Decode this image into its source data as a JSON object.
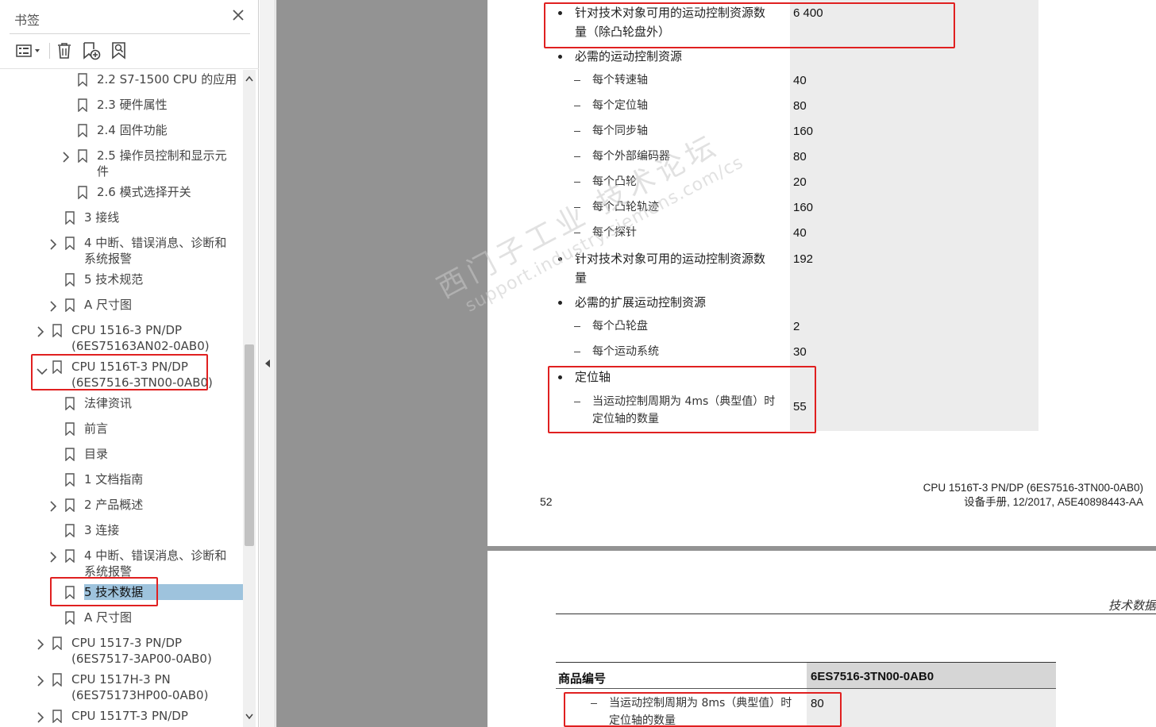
{
  "sidebar": {
    "title": "书签",
    "close_icon": "close-icon",
    "toolbar": [
      "options-menu-icon",
      "delete-bookmark-icon",
      "new-bookmark-icon",
      "find-bookmark-icon"
    ],
    "items": [
      {
        "label": "2.2 S7-1500 CPU 的应用",
        "expandable": false
      },
      {
        "label": "2.3 硬件属性",
        "expandable": false
      },
      {
        "label": "2.4 固件功能",
        "expandable": false
      },
      {
        "label": "2.5 操作员控制和显示元",
        "label2": "件",
        "expandable": true
      },
      {
        "label": "2.6 模式选择开关",
        "expandable": false
      },
      {
        "label": "3 接线",
        "expandable": false
      },
      {
        "label": "4 中断、错误消息、诊断和",
        "label2": "系统报警",
        "expandable": true
      },
      {
        "label": "5 技术规范",
        "expandable": false
      },
      {
        "label": "A 尺寸图",
        "expandable": true
      },
      {
        "label": "CPU 1516-3 PN/DP",
        "label2": "(6ES75163AN02-0AB0)",
        "expandable": true
      },
      {
        "label": "CPU 1516T-3 PN/DP",
        "label2": "(6ES7516-3TN00-0AB0)",
        "expandable": true,
        "expanded": true
      },
      {
        "label": "法律资讯",
        "expandable": false
      },
      {
        "label": "前言",
        "expandable": false
      },
      {
        "label": "目录",
        "expandable": false
      },
      {
        "label": "1 文档指南",
        "expandable": false
      },
      {
        "label": "2 产品概述",
        "expandable": true
      },
      {
        "label": "3 连接",
        "expandable": false
      },
      {
        "label": "4 中断、错误消息、诊断和",
        "label2": "系统报警",
        "expandable": true
      },
      {
        "label": "5 技术数据",
        "expandable": false,
        "selected": true
      },
      {
        "label": "A 尺寸图",
        "expandable": false
      },
      {
        "label": "CPU 1517-3 PN/DP",
        "label2": "(6ES7517-3AP00-0AB0)",
        "expandable": true
      },
      {
        "label": "CPU 1517H-3 PN",
        "label2": "(6ES75173HP00-0AB0)",
        "expandable": true
      },
      {
        "label": "CPU 1517T-3 PN/DP",
        "expandable": true
      }
    ]
  },
  "doc": {
    "rows": [
      {
        "kind": "bullet",
        "text": "针对技术对象可用的运动控制资源数",
        "text2": "量（除凸轮盘外）",
        "value": "6 400"
      },
      {
        "kind": "bullet",
        "text": "必需的运动控制资源",
        "value": ""
      },
      {
        "kind": "dash",
        "text": "每个转速轴",
        "value": "40"
      },
      {
        "kind": "dash",
        "text": "每个定位轴",
        "value": "80"
      },
      {
        "kind": "dash",
        "text": "每个同步轴",
        "value": "160"
      },
      {
        "kind": "dash",
        "text": "每个外部编码器",
        "value": "80"
      },
      {
        "kind": "dash",
        "text": "每个凸轮",
        "value": "20"
      },
      {
        "kind": "dash",
        "text": "每个凸轮轨迹",
        "value": "160"
      },
      {
        "kind": "dash",
        "text": "每个探针",
        "value": "40"
      },
      {
        "kind": "bullet",
        "text": "针对技术对象可用的运动控制资源数",
        "text2": "量",
        "value": "192"
      },
      {
        "kind": "bullet",
        "text": "必需的扩展运动控制资源",
        "value": ""
      },
      {
        "kind": "dash",
        "text": "每个凸轮盘",
        "value": "2"
      },
      {
        "kind": "dash",
        "text": "每个运动系统",
        "value": "30"
      },
      {
        "kind": "bullet",
        "text": "定位轴",
        "value": ""
      },
      {
        "kind": "dash",
        "text": "当运动控制周期为 4ms（典型值）时",
        "text2": "定位轴的数量",
        "value": "55"
      }
    ],
    "footer": {
      "page_number": "52",
      "title_line1": "CPU 1516T-3 PN/DP (6ES7516-3TN00-0AB0)",
      "title_line2": "设备手册, 12/2017, A5E40898443-AA"
    },
    "page2": {
      "header": "技术数据",
      "table_label_head": "商品编号",
      "table_value_head": "6ES7516-3TN00-0AB0",
      "row_text": "当运动控制周期为 8ms（典型值）时",
      "row_text2": "定位轴的数量",
      "row_value": "80"
    }
  },
  "watermark": {
    "line1": "西门子工业 技术论坛",
    "line2": "support.industry.siemens.com/cs"
  },
  "colors": {
    "highlight_red": "#e02020",
    "selection_blue": "#9ec3dd",
    "doc_background": "#939393",
    "value_column": "#ececec"
  }
}
